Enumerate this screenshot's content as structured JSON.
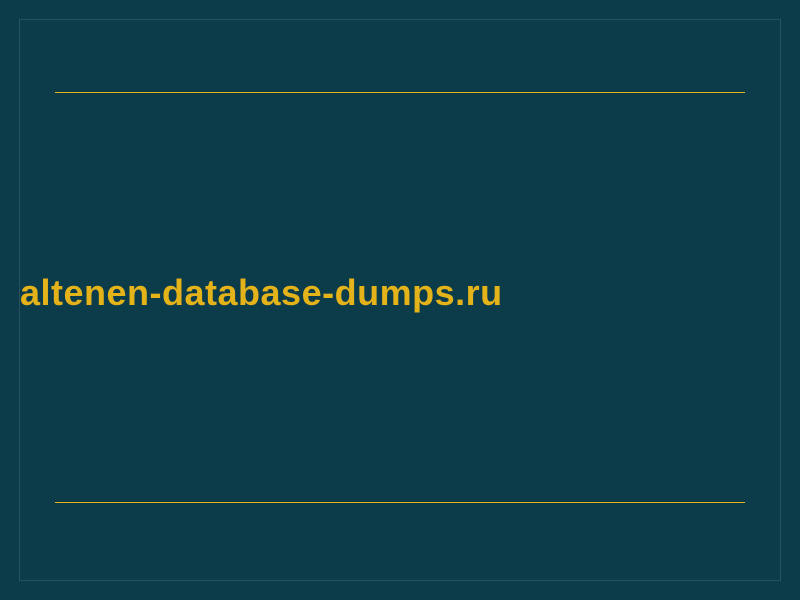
{
  "main": {
    "text": "altenen-database-dumps.ru"
  },
  "colors": {
    "background": "#0c3b4a",
    "accent": "#e4b31a"
  }
}
